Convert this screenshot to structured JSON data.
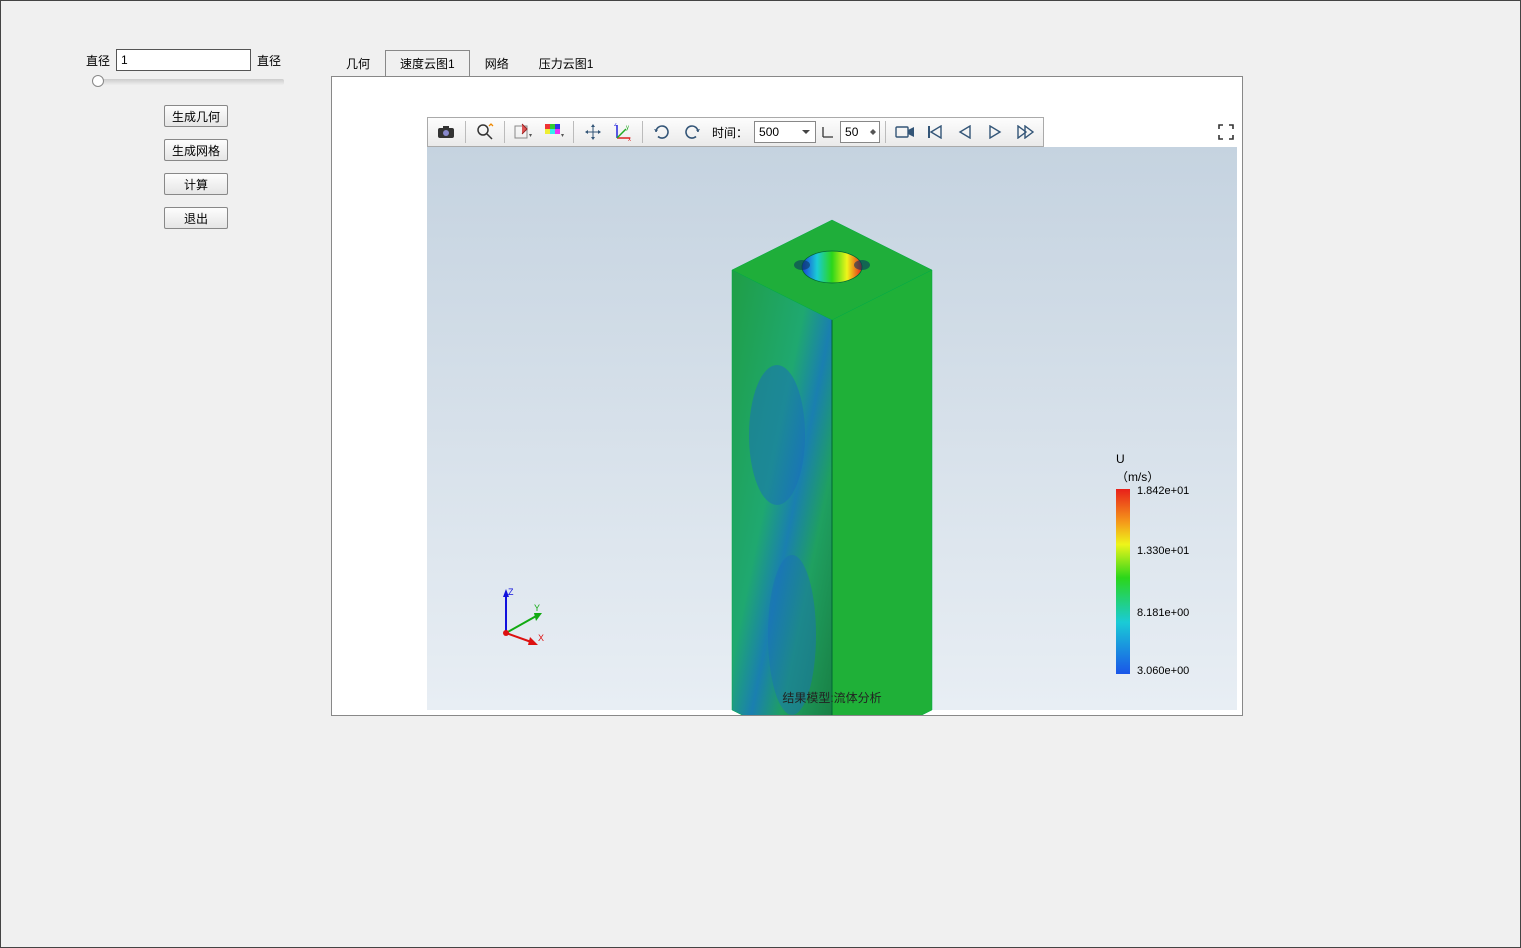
{
  "sidebar": {
    "diameter_label_left": "直径",
    "diameter_label_right": "直径",
    "diameter_value": "1",
    "buttons": {
      "gen_geometry": "生成几何",
      "gen_mesh": "生成网格",
      "compute": "计算",
      "exit": "退出"
    }
  },
  "tabs": {
    "geometry": "几何",
    "velocity_cloud": "速度云图1",
    "mesh": "网络",
    "pressure_cloud": "压力云图1",
    "active": "velocity_cloud"
  },
  "toolbar": {
    "time_label": "时间：",
    "time_value": "500",
    "step_value": "50",
    "icons": {
      "camera": "camera-icon",
      "zoom": "zoom-icon",
      "select": "select-icon",
      "color": "color-icon",
      "move": "move-icon",
      "axes": "axes-icon",
      "rotate_ccw": "rotate-ccw-icon",
      "rotate_cw": "rotate-cw-icon",
      "record": "record-icon",
      "first": "first-frame-icon",
      "prev": "prev-frame-icon",
      "play": "play-icon",
      "next": "next-frame-icon",
      "fullscreen": "fullscreen-icon"
    }
  },
  "viewport": {
    "model_label": "结果模型:流体分析",
    "axis_x": "X",
    "axis_y": "Y",
    "axis_z": "Z"
  },
  "colorbar": {
    "title": "U",
    "unit": "（m/s）",
    "ticks": {
      "t0": "1.842e+01",
      "t1": "1.330e+01",
      "t2": "8.181e+00",
      "t3": "3.060e+00"
    }
  }
}
